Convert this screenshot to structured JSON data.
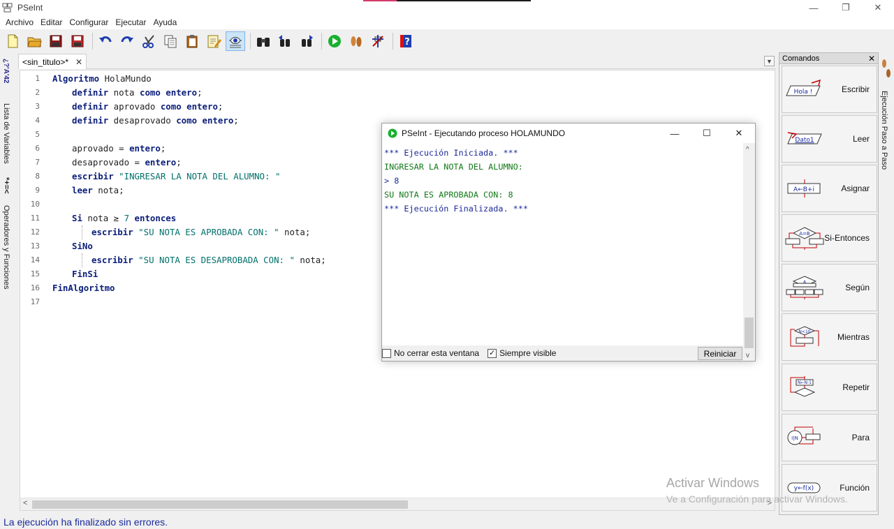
{
  "window": {
    "title": "PSeInt",
    "controls": [
      "—",
      "❐",
      "✕"
    ]
  },
  "menu": [
    "Archivo",
    "Editar",
    "Configurar",
    "Ejecutar",
    "Ayuda"
  ],
  "toolbar": {
    "icons": [
      "new-file-icon",
      "open-file-icon",
      "save-icon",
      "save-as-icon",
      "undo-icon",
      "redo-icon",
      "cut-icon",
      "copy-icon",
      "paste-icon",
      "edit-icon",
      "find-icon",
      "find-icon-2",
      "indent-icon",
      "indent-icon-2",
      "run-icon",
      "step-by-step-icon",
      "draw-flowchart-icon",
      "help-icon"
    ]
  },
  "left_panel": {
    "variables_tab": "Lista de Variables",
    "variables_glyph": "¿?'A'42",
    "operators_tab": "Operadores y Funciones",
    "operators_glyph": "*+=<"
  },
  "right_panel": {
    "step_tab": "Ejecución Paso a Paso"
  },
  "editor": {
    "tab_label": "<sin_titulo>*",
    "tab_close": "✕",
    "line_numbers": [
      "1",
      "2",
      "3",
      "4",
      "5",
      "6",
      "7",
      "8",
      "9",
      "10",
      "11",
      "12",
      "13",
      "14",
      "15",
      "16",
      "17"
    ],
    "code": {
      "l1_kw": "Algoritmo",
      "l1_name": " HolaMundo",
      "l2_kw1": "definir",
      "l2_var": " nota ",
      "l2_kw2": "como",
      "l2_sp": " ",
      "l2_kw3": "entero",
      "l2_end": ";",
      "l3_kw1": "definir",
      "l3_var": " aprovado ",
      "l3_kw2": "como",
      "l3_sp": " ",
      "l3_kw3": "entero",
      "l3_end": ";",
      "l4_kw1": "definir",
      "l4_var": " desaprovado ",
      "l4_kw2": "como",
      "l4_sp": " ",
      "l4_kw3": "entero",
      "l4_end": ";",
      "l6_var": "aprovado = ",
      "l6_kw": "entero",
      "l6_end": ";",
      "l7_var": "desaprovado = ",
      "l7_kw": "entero",
      "l7_end": ";",
      "l8_kw": "escribir",
      "l8_str": " \"INGRESAR LA NOTA DEL ALUMNO: \"",
      "l9_kw": "leer",
      "l9_var": " nota;",
      "l11_kw1": "Si",
      "l11_cond": " nota ≥ ",
      "l11_num": "7",
      "l11_sp": " ",
      "l11_kw2": "entonces",
      "l12_kw": "escribir",
      "l12_str": " \"SU NOTA ES APROBADA CON: \"",
      "l12_var": " nota;",
      "l13_kw": "SiNo",
      "l14_kw": "escribir",
      "l14_str": " \"SU NOTA ES DESAPROBADA CON: \"",
      "l14_var": " nota;",
      "l15_kw": "FinSi",
      "l16_kw": "FinAlgoritmo"
    }
  },
  "commands_panel": {
    "title": "Comandos",
    "close": "✕",
    "items": [
      {
        "label": "Escribir",
        "icon_text": "Hola !"
      },
      {
        "label": "Leer",
        "icon_text": "Dato1"
      },
      {
        "label": "Asignar",
        "icon_text": "A←B+i"
      },
      {
        "label": "Si-Entonces",
        "icon_text": "A=B"
      },
      {
        "label": "Según",
        "icon_text": "A"
      },
      {
        "label": "Mientras",
        "icon_text": "N<10"
      },
      {
        "label": "Repetir",
        "icon_text": "N←N-1"
      },
      {
        "label": "Para",
        "icon_text": "I|N"
      },
      {
        "label": "Función",
        "icon_text": "y←f(x)"
      }
    ]
  },
  "run_window": {
    "title": "PSeInt - Ejecutando proceso HOLAMUNDO",
    "controls": [
      "—",
      "☐",
      "✕"
    ],
    "console": [
      "*** Ejecución Iniciada. ***",
      "INGRESAR LA NOTA DEL ALUMNO:",
      "> 8",
      "SU NOTA ES APROBADA CON: 8",
      "*** Ejecución Finalizada. ***"
    ],
    "no_close_label": "No cerrar esta ventana",
    "no_close_checked": false,
    "always_visible_label": "Siempre visible",
    "always_visible_checked": true,
    "always_visible_mark": "✓",
    "reset_label": "Reiniciar"
  },
  "watermark": {
    "line1": "Activar Windows",
    "line2": "Ve a Configuración para activar Windows."
  },
  "status": "La ejecución ha finalizado sin errores.",
  "colors": {
    "keyword": "#0b1e7a",
    "string": "#00706a",
    "console_green": "#13781a",
    "console_blue": "#1c2a9a",
    "status_blue": "#1a2a9c",
    "accent_red": "#c00000"
  }
}
